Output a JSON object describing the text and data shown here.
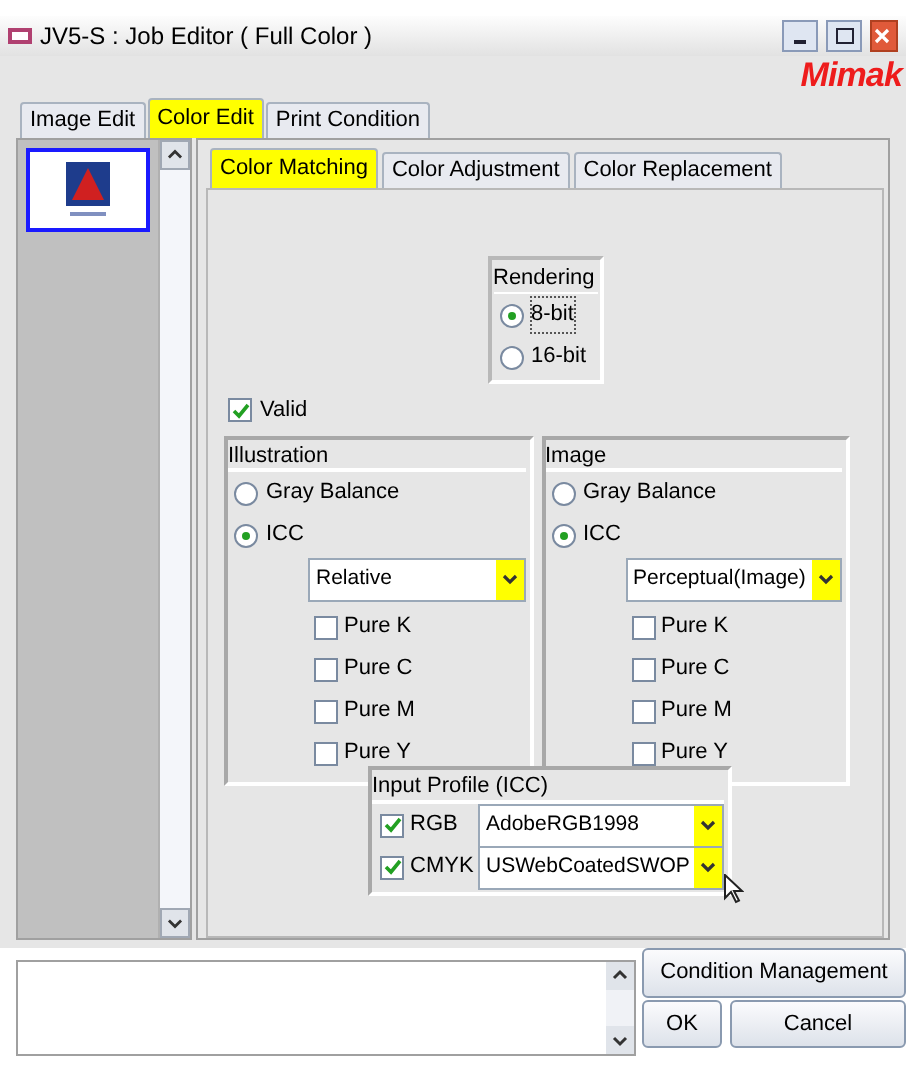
{
  "window": {
    "title": "JV5-S : Job Editor ( Full Color )"
  },
  "logo": "Mimak",
  "tabs": [
    {
      "label": "Image Edit",
      "selected": false
    },
    {
      "label": "Color Edit",
      "selected": true
    },
    {
      "label": "Print Condition",
      "selected": false
    }
  ],
  "subtabs": [
    {
      "label": "Color Matching",
      "selected": true
    },
    {
      "label": "Color Adjustment",
      "selected": false
    },
    {
      "label": "Color Replacement",
      "selected": false
    }
  ],
  "rendering": {
    "title": "Rendering",
    "options": [
      {
        "label": "8-bit",
        "selected": true
      },
      {
        "label": "16-bit",
        "selected": false
      }
    ]
  },
  "valid": {
    "label": "Valid",
    "checked": true
  },
  "groups": [
    {
      "title": "Illustration",
      "modes": [
        {
          "label": "Gray Balance",
          "selected": false
        },
        {
          "label": "ICC",
          "selected": true
        }
      ],
      "intent": "Relative",
      "options": [
        {
          "label": "Pure K",
          "checked": false
        },
        {
          "label": "Pure C",
          "checked": false
        },
        {
          "label": "Pure M",
          "checked": false
        },
        {
          "label": "Pure Y",
          "checked": false
        }
      ]
    },
    {
      "title": "Image",
      "modes": [
        {
          "label": "Gray Balance",
          "selected": false
        },
        {
          "label": "ICC",
          "selected": true
        }
      ],
      "intent": "Perceptual(Image)",
      "options": [
        {
          "label": "Pure K",
          "checked": false
        },
        {
          "label": "Pure C",
          "checked": false
        },
        {
          "label": "Pure M",
          "checked": false
        },
        {
          "label": "Pure Y",
          "checked": false
        }
      ]
    }
  ],
  "input_profile": {
    "title": "Input Profile (ICC)",
    "rows": [
      {
        "label": "RGB",
        "checked": true,
        "value": "AdobeRGB1998"
      },
      {
        "label": "CMYK",
        "checked": true,
        "value": "USWebCoatedSWOP"
      }
    ]
  },
  "buttons": {
    "condition": "Condition Management",
    "ok": "OK",
    "cancel": "Cancel"
  }
}
